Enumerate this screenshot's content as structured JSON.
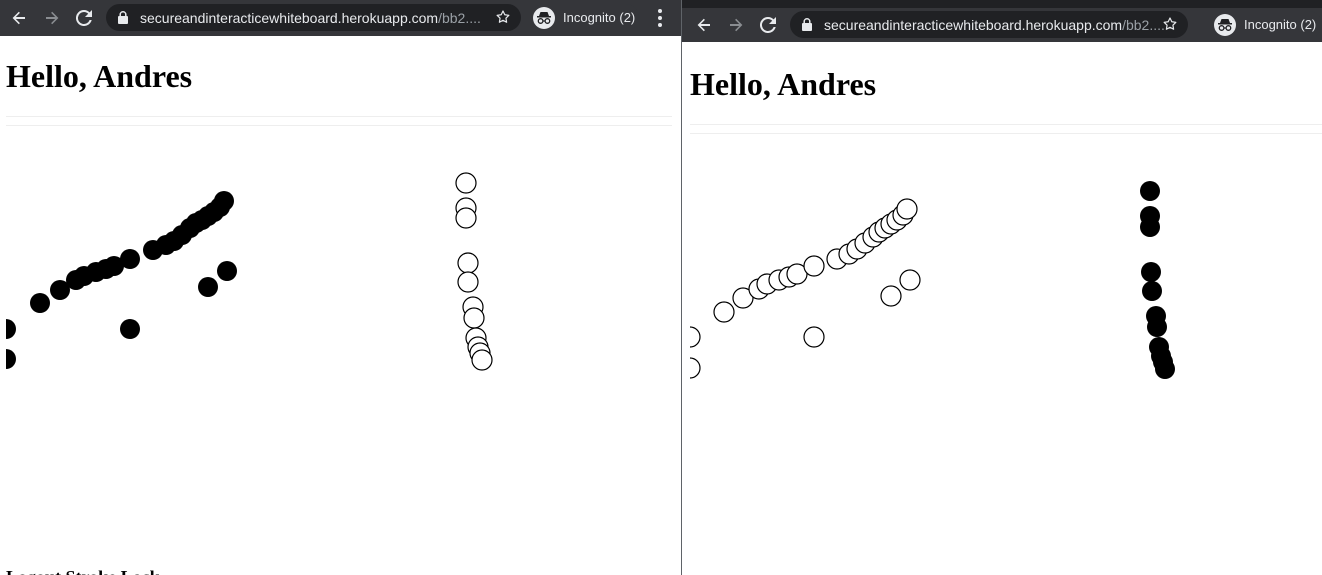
{
  "left_window": {
    "url_host": "secureandinteracticewhiteboard.herokuapp.com",
    "url_path": "/bb2....",
    "incognito_label": "Incognito (2)",
    "greeting": "Hello, Andres",
    "cut_text": "Logout  Stroke  Lock",
    "icons": [
      "back-arrow-icon",
      "forward-arrow-icon",
      "reload-icon",
      "lock-icon",
      "star-icon",
      "incognito-icon",
      "kebab-menu-icon"
    ],
    "colors": {
      "toolbar": "#35363a",
      "omnibox": "#202124",
      "filled_dot": "#000000",
      "hollow_dot": "#ffffff"
    }
  },
  "right_window": {
    "url_host": "secureandinteracticewhiteboard.herokuapp.com",
    "url_path": "/bb2....",
    "incognito_label": "Incognito (2)",
    "greeting": "Hello, Andres",
    "icons": [
      "back-arrow-icon",
      "forward-arrow-icon",
      "reload-icon",
      "lock-icon",
      "star-icon",
      "incognito-icon"
    ],
    "colors": {
      "toolbar": "#35363a",
      "tabstrip": "#202124",
      "filled_dot": "#000000",
      "hollow_dot": "#ffffff"
    }
  }
}
